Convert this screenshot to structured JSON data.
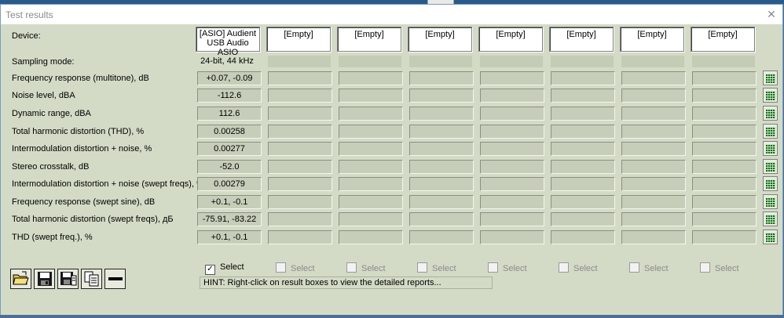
{
  "window": {
    "title": "Test results"
  },
  "device_label": "Device:",
  "devices": [
    "[ASIO] Audient USB Audio ASIO",
    "[Empty]",
    "[Empty]",
    "[Empty]",
    "[Empty]",
    "[Empty]",
    "[Empty]",
    "[Empty]"
  ],
  "sampling": {
    "label": "Sampling mode:",
    "values": [
      "24-bit, 44 kHz",
      "",
      "",
      "",
      "",
      "",
      "",
      ""
    ]
  },
  "rows": [
    {
      "label": "Frequency response (multitone), dB",
      "values": [
        "+0.07, -0.09",
        "",
        "",
        "",
        "",
        "",
        "",
        ""
      ]
    },
    {
      "label": "Noise level, dBA",
      "values": [
        "-112.6",
        "",
        "",
        "",
        "",
        "",
        "",
        ""
      ]
    },
    {
      "label": "Dynamic range, dBA",
      "values": [
        "112.6",
        "",
        "",
        "",
        "",
        "",
        "",
        ""
      ]
    },
    {
      "label": "Total harmonic distortion (THD), %",
      "values": [
        "0.00258",
        "",
        "",
        "",
        "",
        "",
        "",
        ""
      ]
    },
    {
      "label": "Intermodulation distortion + noise, %",
      "values": [
        "0.00277",
        "",
        "",
        "",
        "",
        "",
        "",
        ""
      ]
    },
    {
      "label": "Stereo crosstalk, dB",
      "values": [
        "-52.0",
        "",
        "",
        "",
        "",
        "",
        "",
        ""
      ]
    },
    {
      "label": "Intermodulation distortion + noise (swept freqs), %",
      "values": [
        "0.00279",
        "",
        "",
        "",
        "",
        "",
        "",
        ""
      ]
    },
    {
      "label": "Frequency response (swept sine), dB",
      "values": [
        "+0.1, -0.1",
        "",
        "",
        "",
        "",
        "",
        "",
        ""
      ]
    },
    {
      "label": "Total harmonic distortion (swept freqs), дБ",
      "values": [
        "-75.91, -83.22",
        "",
        "",
        "",
        "",
        "",
        "",
        ""
      ]
    },
    {
      "label": "THD (swept freq.), %",
      "values": [
        "+0.1, -0.1",
        "",
        "",
        "",
        "",
        "",
        "",
        ""
      ]
    }
  ],
  "select": {
    "label": "Select",
    "checked": [
      true,
      false,
      false,
      false,
      false,
      false,
      false,
      false
    ],
    "enabled": [
      true,
      false,
      false,
      false,
      false,
      false,
      false,
      false
    ]
  },
  "hint": "HINT: Right-click on result boxes to view the detailed reports...",
  "toolbar": {
    "icons": [
      "open-folder-icon",
      "save-icon",
      "save-all-icon",
      "copy-icon",
      "remove-icon"
    ]
  },
  "icons": {
    "close": "✕",
    "check": "✓"
  }
}
